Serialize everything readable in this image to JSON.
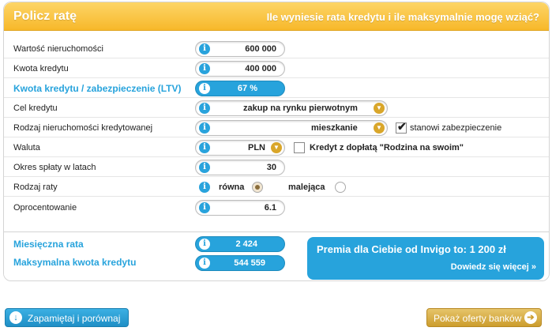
{
  "header": {
    "title": "Policz ratę",
    "subtitle": "Ile wyniesie rata kredytu i ile maksymalnie mogę wziąć?"
  },
  "form": {
    "property_value": {
      "label": "Wartość nieruchomości",
      "value": "600 000"
    },
    "loan_amount": {
      "label": "Kwota kredytu",
      "value": "400 000"
    },
    "ltv": {
      "label": "Kwota kredytu / zabezpieczenie (LTV)",
      "value": "67 %"
    },
    "purpose": {
      "label": "Cel kredytu",
      "value": "zakup na rynku pierwotnym"
    },
    "property_type": {
      "label": "Rodzaj nieruchomości kredytowanej",
      "value": "mieszkanie",
      "collateral_label": "stanowi zabezpieczenie",
      "collateral_checked": true
    },
    "currency": {
      "label": "Waluta",
      "value": "PLN",
      "program_label": "Kredyt z dopłatą \"Rodzina na swoim\"",
      "program_checked": false
    },
    "term": {
      "label": "Okres spłaty w latach",
      "value": "30"
    },
    "installment_type": {
      "label": "Rodzaj raty",
      "options": [
        "równa",
        "malejąca"
      ],
      "selected": "równa"
    },
    "interest": {
      "label": "Oprocentowanie",
      "value": "6.1"
    }
  },
  "results": {
    "monthly_installment": {
      "label": "Miesięczna rata",
      "value": "2 424"
    },
    "max_loan": {
      "label": "Maksymalna kwota kredytu",
      "value": "544 559"
    }
  },
  "promo": {
    "text": "Premia dla Ciebie od Invigo to: 1 200 zł",
    "link": "Dowiedz się więcej »"
  },
  "buttons": {
    "remember": "Zapamiętaj i porównaj",
    "show_offers": "Pokaż oferty banków"
  },
  "icons": {
    "info": "i",
    "dropdown": "▼",
    "check": "✔",
    "down_arrow": "↓",
    "right_arrow": "➔"
  },
  "colors": {
    "accent_blue": "#27a3dc",
    "header_yellow": "#f7b82a",
    "gold_button": "#cc9d2d"
  }
}
